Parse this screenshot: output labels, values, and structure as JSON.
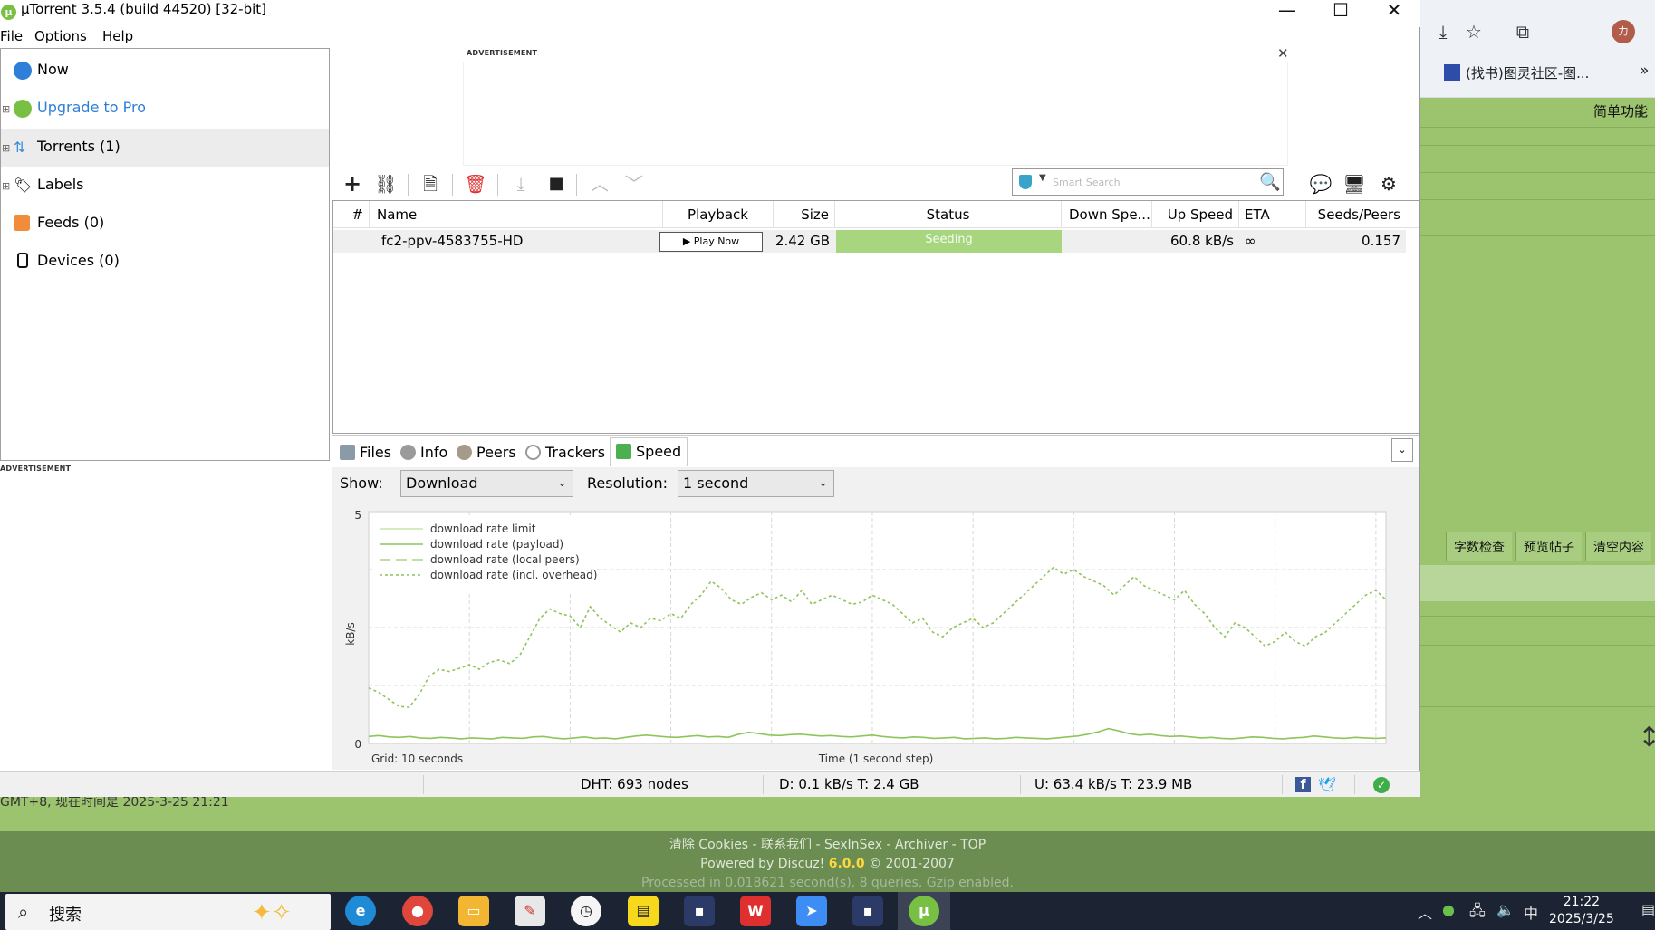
{
  "window": {
    "title": "µTorrent 3.5.4  (build 44520) [32-bit]",
    "controls": {
      "minimize": "—",
      "maximize": "☐",
      "close": "✕"
    }
  },
  "menu": {
    "items": [
      "File",
      "Options",
      "Help"
    ]
  },
  "sidebar": {
    "items": [
      {
        "label": "Now",
        "icon": "now-icon",
        "color": "#2f7fd8"
      },
      {
        "label": "Upgrade to Pro",
        "icon": "utorrent-logo-icon",
        "color": "#2f7fd8"
      },
      {
        "label": "Torrents (1)",
        "icon": "torrents-icon",
        "color": "#000000"
      },
      {
        "label": "Labels",
        "icon": "tag-icon",
        "color": "#000000"
      },
      {
        "label": "Feeds (0)",
        "icon": "rss-icon",
        "color": "#000000"
      },
      {
        "label": "Devices (0)",
        "icon": "device-icon",
        "color": "#000000"
      }
    ],
    "ad_label": "ADVERTISEMENT"
  },
  "top_ad": {
    "label": "ADVERTISEMENT",
    "close": "✕"
  },
  "toolbar": {
    "buttons": [
      "add-torrent-icon",
      "add-link-icon",
      "create-torrent-icon",
      "remove-icon",
      "start-icon",
      "stop-icon",
      "move-up-icon",
      "move-down-icon",
      "chat-icon",
      "remote-icon",
      "settings-icon"
    ],
    "search_placeholder": "Smart Search"
  },
  "list": {
    "columns": [
      "#",
      "Name",
      "Playback",
      "Size",
      "Status",
      "Down Spe...",
      "Up Speed",
      "ETA",
      "Seeds/Peers"
    ],
    "rows": [
      {
        "num": "",
        "name": "fc2-ppv-4583755-HD",
        "playback": "▶ Play Now",
        "size": "2.42 GB",
        "status": "Seeding",
        "down_speed": "",
        "up_speed": "60.8 kB/s",
        "eta": "∞",
        "seeds_peers": "0.157"
      }
    ]
  },
  "tabs": {
    "items": [
      {
        "label": "Files",
        "icon": "files-icon"
      },
      {
        "label": "Info",
        "icon": "info-icon"
      },
      {
        "label": "Peers",
        "icon": "peers-icon"
      },
      {
        "label": "Trackers",
        "icon": "trackers-icon"
      },
      {
        "label": "Speed",
        "icon": "speed-icon"
      }
    ],
    "active": "Speed",
    "toggle": "⌄"
  },
  "speed": {
    "show_label": "Show:",
    "show_value": "Download",
    "resolution_label": "Resolution:",
    "resolution_value": "1 second"
  },
  "chart_data": {
    "type": "line",
    "title": "",
    "xlabel": "Time (1 second step)",
    "ylabel": "kB/s",
    "grid_label": "Grid: 10 seconds",
    "y_ticks": [
      "5",
      "0"
    ],
    "ylim": [
      0,
      5
    ],
    "grid": true,
    "legend_position": "top-left",
    "colors": {
      "limit": "#c9e5a8",
      "payload": "#8ec45c",
      "local": "#aad488",
      "overhead": "#8ec45c"
    },
    "series": [
      {
        "name": "download rate limit",
        "values": []
      },
      {
        "name": "download rate (payload)",
        "values": [
          0.15,
          0.17,
          0.14,
          0.13,
          0.15,
          0.12,
          0.11,
          0.13,
          0.12,
          0.1,
          0.12,
          0.11,
          0.1,
          0.13,
          0.12,
          0.11,
          0.14,
          0.15,
          0.12,
          0.1,
          0.12,
          0.14,
          0.11,
          0.12,
          0.1,
          0.13,
          0.16,
          0.18,
          0.16,
          0.14,
          0.13,
          0.15,
          0.17,
          0.14,
          0.15,
          0.13,
          0.2,
          0.24,
          0.21,
          0.18,
          0.17,
          0.19,
          0.2,
          0.18,
          0.16,
          0.17,
          0.15,
          0.14,
          0.16,
          0.18,
          0.15,
          0.13,
          0.12,
          0.14,
          0.13,
          0.11,
          0.12,
          0.13,
          0.1,
          0.11,
          0.12,
          0.1,
          0.11,
          0.13,
          0.12,
          0.11,
          0.1,
          0.12,
          0.14,
          0.16,
          0.2,
          0.25,
          0.32,
          0.27,
          0.21,
          0.18,
          0.2,
          0.17,
          0.15,
          0.16,
          0.14,
          0.12,
          0.13,
          0.11,
          0.1,
          0.12,
          0.14,
          0.13,
          0.11,
          0.1,
          0.12,
          0.13,
          0.16,
          0.14,
          0.12,
          0.11,
          0.13,
          0.12,
          0.11,
          0.12
        ]
      },
      {
        "name": "download rate (local peers)",
        "values": []
      },
      {
        "name": "download rate (incl. overhead)",
        "values": [
          1.2,
          1.1,
          0.95,
          0.8,
          0.78,
          1.05,
          1.45,
          1.6,
          1.55,
          1.62,
          1.7,
          1.6,
          1.75,
          1.8,
          1.72,
          1.9,
          2.3,
          2.7,
          2.9,
          2.8,
          2.75,
          2.5,
          2.95,
          2.7,
          2.55,
          2.4,
          2.6,
          2.5,
          2.7,
          2.65,
          2.8,
          2.7,
          3.0,
          3.2,
          3.5,
          3.35,
          3.1,
          3.0,
          3.15,
          3.25,
          3.1,
          3.2,
          3.05,
          3.3,
          3.0,
          3.1,
          3.2,
          3.1,
          3.0,
          3.05,
          3.2,
          3.1,
          3.0,
          2.8,
          2.6,
          2.7,
          2.4,
          2.3,
          2.5,
          2.6,
          2.7,
          2.5,
          2.6,
          2.8,
          3.0,
          3.2,
          3.4,
          3.6,
          3.8,
          3.65,
          3.75,
          3.6,
          3.5,
          3.4,
          3.2,
          3.4,
          3.6,
          3.4,
          3.3,
          3.2,
          3.1,
          3.3,
          3.0,
          2.8,
          2.5,
          2.3,
          2.6,
          2.5,
          2.3,
          2.1,
          2.2,
          2.4,
          2.2,
          2.1,
          2.3,
          2.4,
          2.6,
          2.8,
          3.0,
          3.2,
          3.3,
          3.1
        ]
      }
    ]
  },
  "statusbar": {
    "dht": "DHT: 693 nodes",
    "download": "D: 0.1 kB/s T: 2.4 GB",
    "upload": "U: 63.4 kB/s T: 23.9 MB",
    "facebook": "f",
    "twitter": "🐦",
    "ok": "✓"
  },
  "browser": {
    "bookmark": "(找书)图灵社区-图...",
    "more": "»",
    "avatar": "力",
    "simple_mode": "简单功能",
    "buttons": [
      "字数检查",
      "预览帖子",
      "清空内容"
    ],
    "time_note": "GMT+8, 现在时间是 2025-3-25 21:21",
    "footer_links": "清除 Cookies - 联系我们 - SexInSex - Archiver - TOP",
    "powered_prefix": "Powered by Discuz! ",
    "powered_version": "6.0.0",
    "powered_suffix": " © 2001-2007",
    "processed": "Processed in 0.018621 second(s), 8 queries, Gzip enabled."
  },
  "taskbar": {
    "search_text": "搜索",
    "apps": [
      "edge-icon",
      "chrome-icon",
      "file-explorer-icon",
      "paint-icon",
      "clock-icon",
      "sticky-notes-icon",
      "app-icon",
      "wps-icon",
      "feishu-icon",
      "app-icon-2",
      "utorrent-icon"
    ],
    "ime": "中",
    "time": "21:22",
    "date": "2025/3/25"
  }
}
